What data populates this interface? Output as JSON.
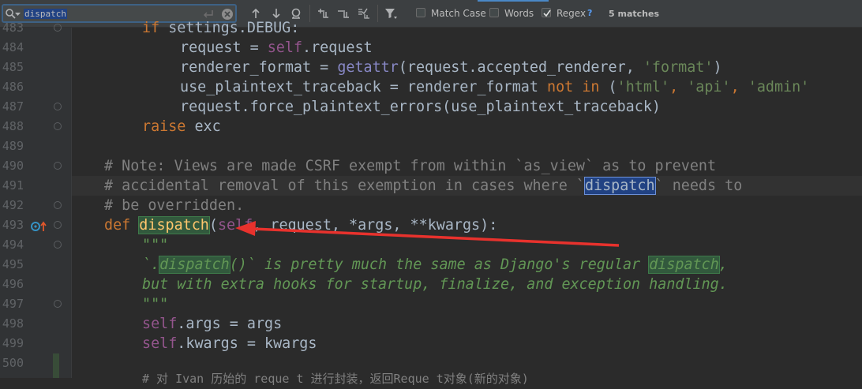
{
  "search": {
    "query": "dispatch",
    "match_case_label": "Match Case",
    "match_case_checked": false,
    "words_label": "Words",
    "words_checked": false,
    "regex_label": "Regex",
    "regex_checked": true,
    "regex_help": "?",
    "match_count": "5 matches"
  },
  "toolbar_icons": [
    "search-icon",
    "history-chevron-icon",
    "newline-icon",
    "clear-search-icon",
    "previous-occurrence-icon",
    "next-occurrence-icon",
    "find-all-occurrences-icon",
    "add-occurrence-icon",
    "remove-occurrence-icon",
    "select-all-occurrences-icon",
    "filter-icon"
  ],
  "editor": {
    "line_numbers": [
      "483",
      "484",
      "485",
      "486",
      "487",
      "488",
      "489",
      "490",
      "491",
      "492",
      "493",
      "494",
      "495",
      "496",
      "497",
      "498",
      "499",
      "500"
    ],
    "code": {
      "l483": [
        "if",
        " settings.DEBUG:"
      ],
      "l484": [
        "request = ",
        "self",
        ".request"
      ],
      "l485": [
        "renderer_format = ",
        "getattr",
        "(request.accepted_renderer, ",
        "'format'",
        ")"
      ],
      "l486": [
        "use_plaintext_traceback = renderer_format ",
        "not in",
        " (",
        "'html'",
        ", ",
        "'api'",
        ", ",
        "'admin'"
      ],
      "l487": [
        "request.force_plaintext_errors(use_plaintext_traceback)"
      ],
      "l488": [
        "raise",
        " exc"
      ],
      "l490": [
        "# Note: Views are made CSRF exempt from within `as_view` as to prevent"
      ],
      "l491": [
        "# accidental removal of this exemption in cases where `",
        "dispatch",
        "` needs to"
      ],
      "l492": [
        "# be overridden."
      ],
      "l493": [
        "def",
        " ",
        "dispatch",
        "(",
        "self",
        ", request, *args, **kwargs):"
      ],
      "l494": [
        "\"\"\""
      ],
      "l495": [
        "`.",
        "dispatch",
        "()` is pretty much the same as Django's regular ",
        "dispatch",
        ","
      ],
      "l496": [
        "but with extra hooks for startup, finalize, and exception handling."
      ],
      "l497": [
        "\"\"\""
      ],
      "l498": [
        "self",
        ".args = args"
      ],
      "l499": [
        "self",
        ".kwargs = kwargs"
      ],
      "l500": [
        ""
      ],
      "l501": [
        "# 对 Ivan 历始的 reque t 进行封装，返回Reque t对象(新的对象)"
      ]
    }
  },
  "colors": {
    "background": "#2b2b2b",
    "gutter": "#313335",
    "keyword": "#cc7832",
    "self": "#94558d",
    "string": "#6a8759",
    "comment": "#808080",
    "docstring": "#629755",
    "function_name": "#ffc66d",
    "match_selected": "#214283",
    "match_other": "#32593d",
    "annotation_arrow": "#e8322d"
  }
}
